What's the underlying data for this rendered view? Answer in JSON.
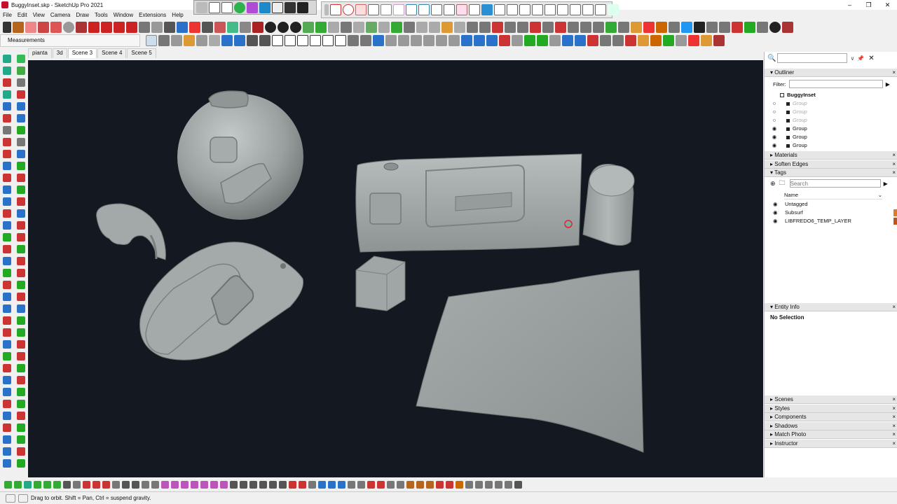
{
  "window": {
    "title": "BuggyInset.skp - SketchUp Pro 2021",
    "controls": [
      "–",
      "❐",
      "✕"
    ]
  },
  "menu": [
    "File",
    "Edit",
    "View",
    "Camera",
    "Draw",
    "Tools",
    "Window",
    "Extensions",
    "Help"
  ],
  "measurements": {
    "label": "Measurements"
  },
  "scenes": [
    "pianta",
    "3d",
    "Scene 3",
    "Scene 4",
    "Scene 5"
  ],
  "active_scene": "Scene 3",
  "status": {
    "message": "Drag to orbit.  Shift = Pan, Ctrl = suspend gravity."
  },
  "tray": {
    "search_placeholder": "",
    "outliner": {
      "title": "Outliner",
      "filter_label": "Filter:",
      "model": "BuggyInset",
      "rows": [
        {
          "label": "Group",
          "visible": false
        },
        {
          "label": "Group",
          "visible": false
        },
        {
          "label": "Group",
          "visible": false
        },
        {
          "label": "Group",
          "visible": true
        },
        {
          "label": "Group",
          "visible": true
        },
        {
          "label": "Group",
          "visible": true
        }
      ]
    },
    "collapsed_panels_top": [
      "Materials",
      "Soften Edges"
    ],
    "tags": {
      "title": "Tags",
      "search_placeholder": "Search",
      "column": "Name",
      "items": [
        {
          "name": "Untagged",
          "color": "#ffffff"
        },
        {
          "name": "Subsurf",
          "color": "#e07b2a"
        },
        {
          "name": "LIBFREDO6_TEMP_LAYER",
          "color": "#c0551a"
        }
      ]
    },
    "entity_info": {
      "title": "Entity Info",
      "value": "No Selection"
    },
    "collapsed_panels_bottom": [
      "Scenes",
      "Styles",
      "Components",
      "Shadows",
      "Match Photo",
      "Instructor"
    ]
  },
  "colors": {
    "viewport_bg": "#141820",
    "model_surface": "#9ea5a4",
    "model_shadow": "#6d7473",
    "model_highlight": "#c6cccb"
  }
}
